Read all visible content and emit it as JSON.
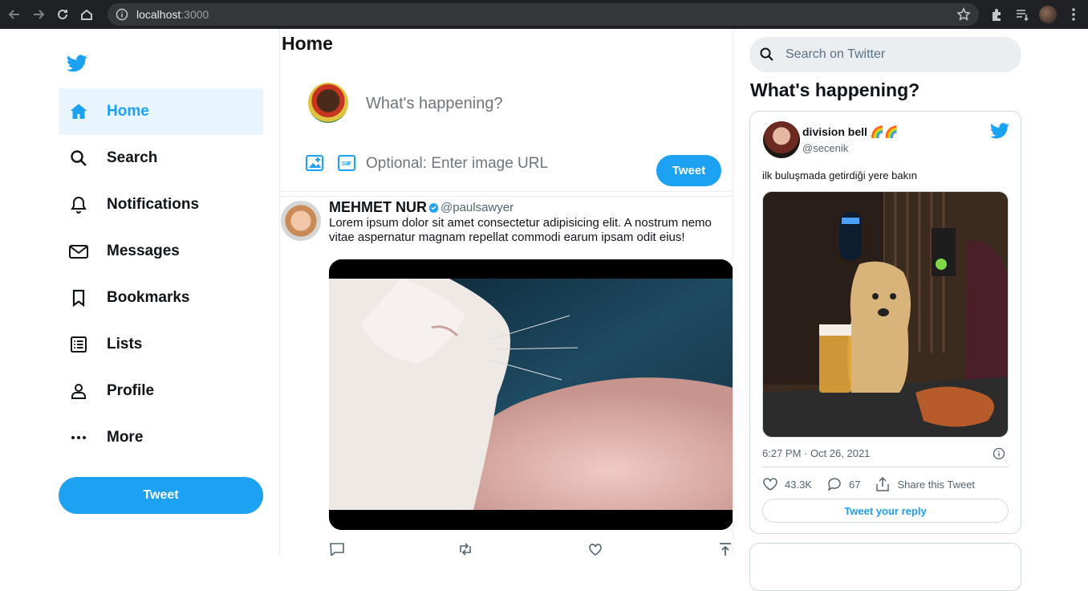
{
  "browser": {
    "url_host": "localhost",
    "url_port": ":3000"
  },
  "sidebar": {
    "items": [
      {
        "label": "Home",
        "icon": "home-icon"
      },
      {
        "label": "Search",
        "icon": "search-icon"
      },
      {
        "label": "Notifications",
        "icon": "bell-icon"
      },
      {
        "label": "Messages",
        "icon": "mail-icon"
      },
      {
        "label": "Bookmarks",
        "icon": "bookmark-icon"
      },
      {
        "label": "Lists",
        "icon": "list-icon"
      },
      {
        "label": "Profile",
        "icon": "person-icon"
      },
      {
        "label": "More",
        "icon": "more-icon"
      }
    ],
    "tweet_label": "Tweet"
  },
  "feed": {
    "title": "Home",
    "compose_placeholder": "What's happening?",
    "image_url_placeholder": "Optional: Enter image URL",
    "tweet_label": "Tweet",
    "post": {
      "name": "MEHMET NUR",
      "handle": "@paulsawyer",
      "text_line1": "Lorem ipsum dolor sit amet consectetur adipisicing elit. A nostrum nemo",
      "text_line2": "vitae aspernatur magnam repellat commodi earum ipsam odit eius!"
    }
  },
  "right": {
    "search_placeholder": "Search on Twitter",
    "happening_title": "What's happening?",
    "embed": {
      "name": "division bell",
      "name_emoji": "🌈🌈",
      "handle": "@secenik",
      "text": "ilk buluşmada getirdiği yere bakın",
      "timestamp": "6:27 PM · Oct 26, 2021",
      "likes": "43.3K",
      "replies": "67",
      "share_label": "Share this Tweet",
      "reply_label": "Tweet your reply"
    }
  },
  "colors": {
    "accent": "#1da1f2",
    "chrome_bg": "#202124",
    "active_bg": "#e8f5fe"
  }
}
